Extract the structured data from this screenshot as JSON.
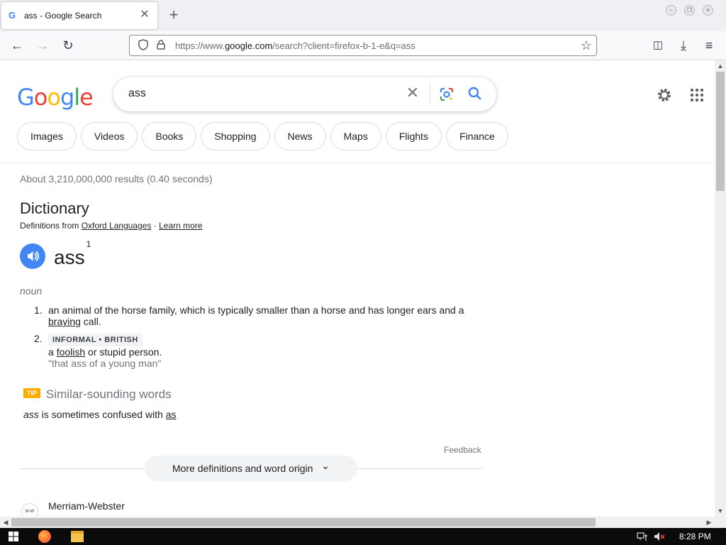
{
  "tab": {
    "title": "ass - Google Search",
    "close": "✕",
    "new_tab": "+"
  },
  "window_controls": {
    "minimize": "–",
    "restore": "❐",
    "close": "✕"
  },
  "nav": {
    "back": "←",
    "forward": "→",
    "reload": "↻",
    "url_prefix": "https://www.",
    "url_host": "google.com",
    "url_path": "/search?client=firefox-b-1-e&q=ass",
    "star": "☆",
    "pocket": "◫",
    "download": "⤓",
    "menu": "≡"
  },
  "google": {
    "logo": [
      "G",
      "o",
      "o",
      "g",
      "l",
      "e"
    ],
    "query": "ass",
    "clear": "✕"
  },
  "chips": [
    "Images",
    "Videos",
    "Books",
    "Shopping",
    "News",
    "Maps",
    "Flights",
    "Finance"
  ],
  "results_stats": "About 3,210,000,000 results (0.40 seconds)",
  "dictionary": {
    "title": "Dictionary",
    "source_prefix": "Definitions from ",
    "source_link": "Oxford Languages",
    "separator": " · ",
    "learn_more": "Learn more",
    "word": "ass",
    "superscript": "1",
    "part_of_speech": "noun",
    "definitions": [
      {
        "num": "1.",
        "text_before": "an animal of the horse family, which is typically smaller than a horse and has longer ears and a ",
        "link": "braying",
        "text_after": " call."
      },
      {
        "num": "2.",
        "label": "INFORMAL • BRITISH",
        "text_before": "a ",
        "link": "foolish",
        "text_after": " or stupid person.",
        "example": "\"that ass of a young man\""
      }
    ]
  },
  "similar": {
    "tip": "TIP",
    "title": "Similar-sounding words",
    "word": "ass",
    "middle": " is sometimes confused with ",
    "link": "as"
  },
  "feedback": "Feedback",
  "more_button": "More definitions and word origin",
  "more_chevron": "⌄",
  "next_result": {
    "logo": "M-W",
    "name": "Merriam-Webster"
  },
  "taskbar": {
    "clock": "8:28 PM"
  },
  "colors": {
    "google_blue": "#4285f4",
    "google_red": "#ea4335",
    "google_yellow": "#fbbc05",
    "google_green": "#34a853",
    "tip": "#f9ab00"
  }
}
